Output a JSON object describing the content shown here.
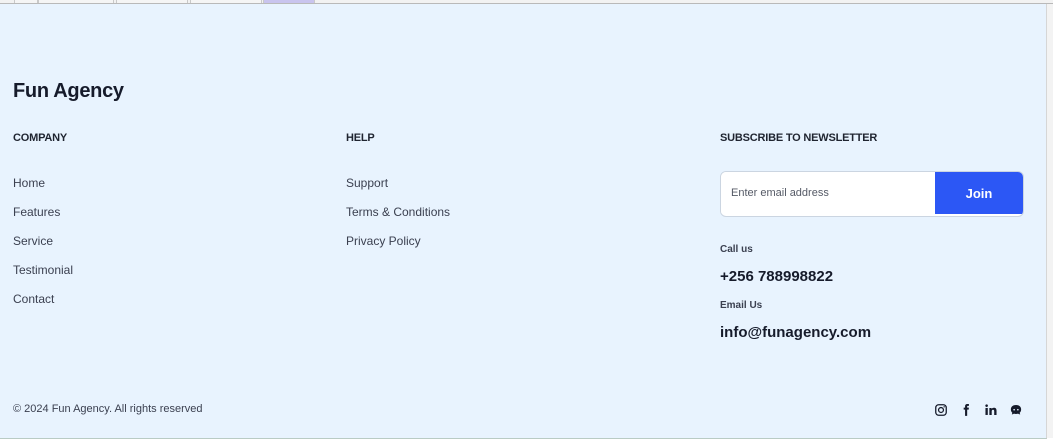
{
  "brand": {
    "name": "Fun Agency"
  },
  "company": {
    "title": "COMPANY",
    "links": [
      {
        "label": "Home"
      },
      {
        "label": "Features"
      },
      {
        "label": "Service"
      },
      {
        "label": "Testimonial"
      },
      {
        "label": "Contact"
      }
    ]
  },
  "help": {
    "title": "HELP",
    "links": [
      {
        "label": "Support"
      },
      {
        "label": "Terms & Conditions"
      },
      {
        "label": "Privacy Policy"
      }
    ]
  },
  "newsletter": {
    "title": "SUBSCRIBE TO NEWSLETTER",
    "email_placeholder": "Enter email address",
    "email_value": "",
    "button_label": "Join"
  },
  "contact": {
    "call_label": "Call us",
    "phone": "+256 788998822",
    "email_label": "Email Us",
    "email": "info@funagency.com"
  },
  "footer": {
    "copyright": "© 2024 Fun Agency. All rights reserved"
  },
  "socials": [
    {
      "icon": "instagram-icon"
    },
    {
      "icon": "facebook-icon"
    },
    {
      "icon": "linkedin-icon"
    },
    {
      "icon": "github-icon"
    }
  ],
  "colors": {
    "background": "#e8f3fe",
    "button": "#2c57f5",
    "text_dark": "#161b2b"
  }
}
